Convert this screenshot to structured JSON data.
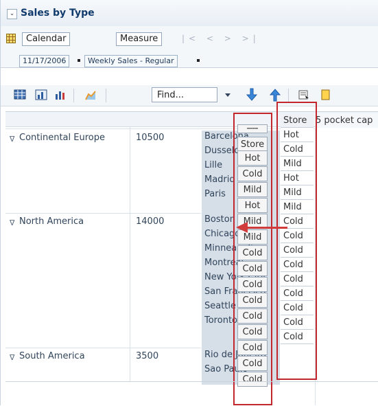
{
  "panel": {
    "title": "Sales by Type",
    "edge_buttons": [
      "Calendar",
      "Measure"
    ],
    "nav_arrows": "|< < > >|",
    "chips": [
      "11/17/2006",
      "Weekly Sales - Regular"
    ]
  },
  "toolbar": {
    "find_placeholder": "Find..."
  },
  "rows": [
    {
      "region": "Continental Europe",
      "value": "10500",
      "cities": [
        "Barcelona",
        "Dusseldorf",
        "Lille",
        "Madrid",
        "Paris"
      ]
    },
    {
      "region": "North America",
      "value": "14000",
      "cities": [
        "Boston",
        "Chicago",
        "Minneapolis",
        "Montreal",
        "New York City",
        "San Francisco",
        "Seattle",
        "Toronto"
      ]
    },
    {
      "region": "South America",
      "value": "3500",
      "cities": [
        "Rio de Janeiro",
        "Sao Paulo"
      ]
    }
  ],
  "store_column": {
    "header": "Store",
    "values": [
      "Hot",
      "Cold",
      "Mild",
      "Hot",
      "Mild",
      "Mild",
      "Cold",
      "Cold",
      "Cold",
      "Cold",
      "Cold",
      "Cold",
      "Cold",
      "Cold",
      "Cold"
    ]
  },
  "ghost_column": {
    "header": "Store",
    "values": [
      "Hot",
      "Cold",
      "Mild",
      "Hot",
      "Mild",
      "Mild",
      "Cold",
      "Cold",
      "Cold",
      "Cold",
      "Cold",
      "Cold",
      "Cold",
      "Cold",
      "Cold"
    ]
  },
  "pocket_header": "5 pocket cap",
  "colors": {
    "title": "#123b6d",
    "highlight": "#c1272d",
    "city_bg": "#d6dee8"
  }
}
